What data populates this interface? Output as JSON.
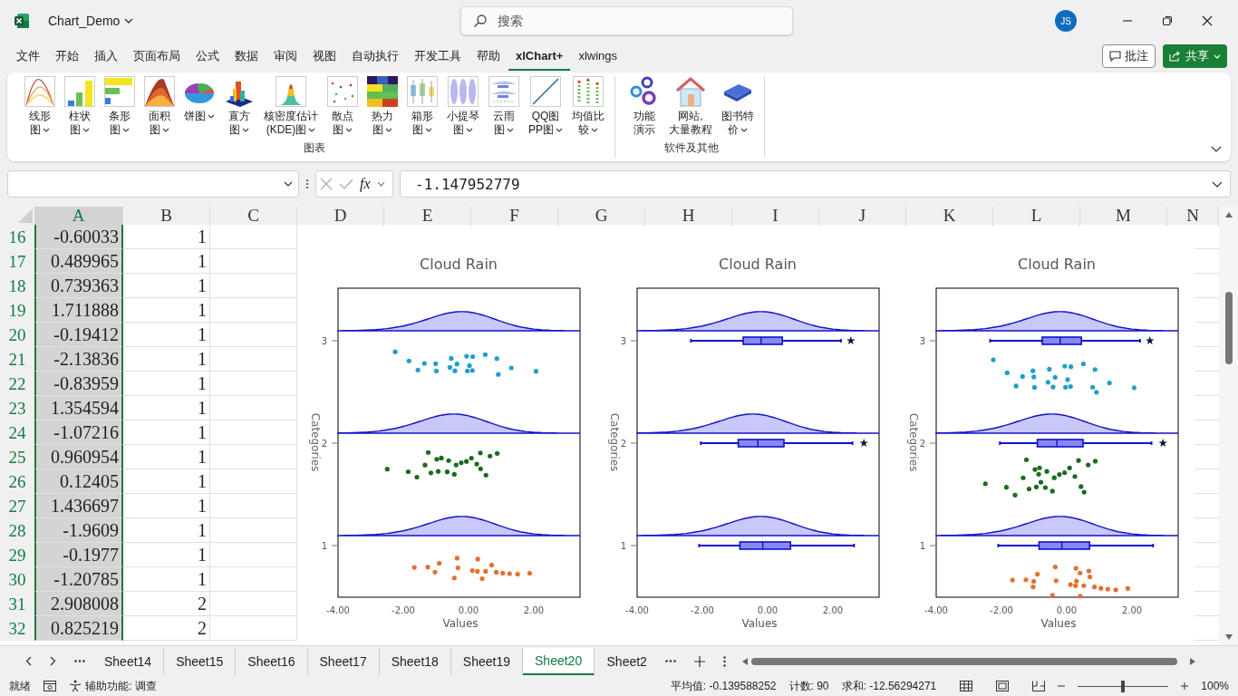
{
  "app": {
    "name": "Chart_Demo",
    "search_placeholder": "搜索",
    "user_initials": "JS"
  },
  "menu_tabs": [
    {
      "label": "文件",
      "selected": false
    },
    {
      "label": "开始",
      "selected": false
    },
    {
      "label": "插入",
      "selected": false
    },
    {
      "label": "页面布局",
      "selected": false
    },
    {
      "label": "公式",
      "selected": false
    },
    {
      "label": "数据",
      "selected": false
    },
    {
      "label": "审阅",
      "selected": false
    },
    {
      "label": "视图",
      "selected": false
    },
    {
      "label": "自动执行",
      "selected": false
    },
    {
      "label": "开发工具",
      "selected": false
    },
    {
      "label": "帮助",
      "selected": false
    },
    {
      "label": "xlChart+",
      "selected": true
    },
    {
      "label": "xlwings",
      "selected": false
    }
  ],
  "header_buttons": {
    "comment": "批注",
    "share": "共享"
  },
  "ribbon_groups": [
    {
      "label": "图表",
      "items": [
        {
          "lines": [
            "线形",
            "图"
          ],
          "dropdown": true,
          "kind": "line"
        },
        {
          "lines": [
            "柱状",
            "图"
          ],
          "dropdown": true,
          "kind": "column"
        },
        {
          "lines": [
            "条形",
            "图"
          ],
          "dropdown": true,
          "kind": "bar"
        },
        {
          "lines": [
            "面积",
            "图"
          ],
          "dropdown": true,
          "kind": "area"
        },
        {
          "lines": [
            "饼图"
          ],
          "dropdown": true,
          "kind": "pie"
        },
        {
          "lines": [
            "直方",
            "图"
          ],
          "dropdown": true,
          "kind": "histogram"
        },
        {
          "lines": [
            "核密度估计",
            "(KDE)图"
          ],
          "dropdown": true,
          "kind": "kde"
        },
        {
          "lines": [
            "散点",
            "图"
          ],
          "dropdown": true,
          "kind": "scatter"
        },
        {
          "lines": [
            "热力",
            "图"
          ],
          "dropdown": true,
          "kind": "heatmap"
        },
        {
          "lines": [
            "箱形",
            "图"
          ],
          "dropdown": true,
          "kind": "boxplot"
        },
        {
          "lines": [
            "小提琴",
            "图"
          ],
          "dropdown": true,
          "kind": "violin"
        },
        {
          "lines": [
            "云雨",
            "图"
          ],
          "dropdown": true,
          "kind": "raincloud"
        },
        {
          "lines": [
            "QQ图",
            "PP图"
          ],
          "dropdown": true,
          "kind": "qq"
        },
        {
          "lines": [
            "均值比",
            "较"
          ],
          "dropdown": true,
          "kind": "means"
        }
      ]
    },
    {
      "label": "软件及其他",
      "items": [
        {
          "lines": [
            "功能",
            "演示"
          ],
          "dropdown": false,
          "kind": "gears"
        },
        {
          "lines": [
            "网站,",
            "大量教程"
          ],
          "dropdown": false,
          "kind": "house"
        },
        {
          "lines": [
            "图书特",
            "价"
          ],
          "dropdown": true,
          "kind": "book"
        }
      ]
    }
  ],
  "formula_bar": {
    "function_button": "fx",
    "formula": "-1.147952779"
  },
  "columns": [
    {
      "label": "A",
      "selected": true
    },
    {
      "label": "B",
      "selected": false
    },
    {
      "label": "C",
      "selected": false
    },
    {
      "label": "D",
      "selected": false
    },
    {
      "label": "E",
      "selected": false
    },
    {
      "label": "F",
      "selected": false
    },
    {
      "label": "G",
      "selected": false
    },
    {
      "label": "H",
      "selected": false
    },
    {
      "label": "I",
      "selected": false
    },
    {
      "label": "J",
      "selected": false
    },
    {
      "label": "K",
      "selected": false
    },
    {
      "label": "L",
      "selected": false
    },
    {
      "label": "M",
      "selected": false
    },
    {
      "label": "N",
      "selected": false
    }
  ],
  "rows": [
    {
      "number": "16",
      "a": "-0.60033",
      "b": "1"
    },
    {
      "number": "17",
      "a": "0.489965",
      "b": "1"
    },
    {
      "number": "18",
      "a": "0.739363",
      "b": "1"
    },
    {
      "number": "19",
      "a": "1.711888",
      "b": "1"
    },
    {
      "number": "20",
      "a": "-0.19412",
      "b": "1"
    },
    {
      "number": "21",
      "a": "-2.13836",
      "b": "1"
    },
    {
      "number": "22",
      "a": "-0.83959",
      "b": "1"
    },
    {
      "number": "23",
      "a": "1.354594",
      "b": "1"
    },
    {
      "number": "24",
      "a": "-1.07216",
      "b": "1"
    },
    {
      "number": "25",
      "a": "0.960954",
      "b": "1"
    },
    {
      "number": "26",
      "a": "0.12405",
      "b": "1"
    },
    {
      "number": "27",
      "a": "1.436697",
      "b": "1"
    },
    {
      "number": "28",
      "a": "-1.9609",
      "b": "1"
    },
    {
      "number": "29",
      "a": "-0.1977",
      "b": "1"
    },
    {
      "number": "30",
      "a": "-1.20785",
      "b": "1"
    },
    {
      "number": "31",
      "a": "2.908008",
      "b": "2"
    },
    {
      "number": "32",
      "a": "0.825219",
      "b": "2"
    }
  ],
  "charts": [
    {
      "kind": "rain",
      "title": "Cloud Rain",
      "xlabel": "Values",
      "ylabel": "Categories",
      "xticks": [
        "-4.00",
        "-2.00",
        "0.00",
        "2.00"
      ],
      "yticks": [
        "3",
        "2",
        "1"
      ]
    },
    {
      "kind": "box",
      "title": "Cloud Rain",
      "xlabel": "Values",
      "ylabel": "Categories",
      "xticks": [
        "-4.00",
        "-2.00",
        "0.00",
        "2.00"
      ],
      "yticks": [
        "3",
        "2",
        "1"
      ]
    },
    {
      "kind": "raincloud",
      "title": "Cloud Rain",
      "xlabel": "Values",
      "ylabel": "Categories",
      "xticks": [
        "-4.00",
        "-2.00",
        "0.00",
        "2.00"
      ],
      "yticks": [
        "3",
        "2",
        "1"
      ]
    }
  ],
  "categories": [
    {
      "color": "#1e9fcc"
    },
    {
      "color": "#1a6b1e"
    },
    {
      "color": "#e07132"
    }
  ],
  "sheet_tabs": [
    {
      "label": "Sheet14",
      "selected": false
    },
    {
      "label": "Sheet15",
      "selected": false
    },
    {
      "label": "Sheet16",
      "selected": false
    },
    {
      "label": "Sheet17",
      "selected": false
    },
    {
      "label": "Sheet18",
      "selected": false
    },
    {
      "label": "Sheet19",
      "selected": false
    },
    {
      "label": "Sheet20",
      "selected": true
    },
    {
      "label": "Sheet2",
      "selected": false
    }
  ],
  "status_bar": {
    "mode": "就绪",
    "accessibility": "辅助功能: 调查",
    "average": "平均值: -0.139588252",
    "count": "计数: 90",
    "sum": "求和: -12.56294271",
    "zoom": "100%",
    "zoom_slider": {
      "level": 0.5
    }
  }
}
